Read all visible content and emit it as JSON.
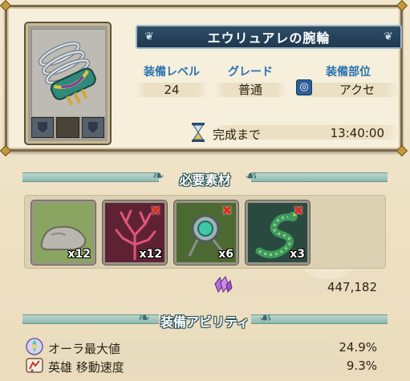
{
  "item": {
    "name": "エウリュアレの腕輪",
    "icon": "bracelet-icon",
    "slots": [
      "filled",
      "empty",
      "filled"
    ]
  },
  "stats": {
    "level_label": "装備レベル",
    "level_value": "24",
    "grade_label": "グレード",
    "grade_value": "普通",
    "part_label": "装備部位",
    "part_value": "アクセ",
    "part_icon": "accessory-icon"
  },
  "timer": {
    "label": "完成まで",
    "value": "13:40:00",
    "icon": "hourglass-icon"
  },
  "materials": {
    "header": "必要素材",
    "items": [
      {
        "name": "stone",
        "icon": "stone-icon",
        "qty": "x12",
        "missing": false
      },
      {
        "name": "coral",
        "icon": "coral-icon",
        "qty": "x12",
        "missing": true
      },
      {
        "name": "gem-pendant",
        "icon": "gem-pendant-icon",
        "qty": "x6",
        "missing": true
      },
      {
        "name": "serpent",
        "icon": "serpent-icon",
        "qty": "x3",
        "missing": true
      }
    ],
    "cost": "447,182",
    "cost_icon": "crystal-icon"
  },
  "abilities": {
    "header": "装備アビリティ",
    "rows": [
      {
        "name": "オーラ最大値",
        "value": "24.9%",
        "icon": "aura-icon"
      },
      {
        "name": "英雄 移動速度",
        "value": "9.3%",
        "icon": "move-speed-icon"
      }
    ]
  },
  "colors": {
    "accent_blue": "#2a72b0",
    "banner": "#1e3850",
    "missing_red": "#e02a1f",
    "header_teal": "#3c6d73"
  }
}
